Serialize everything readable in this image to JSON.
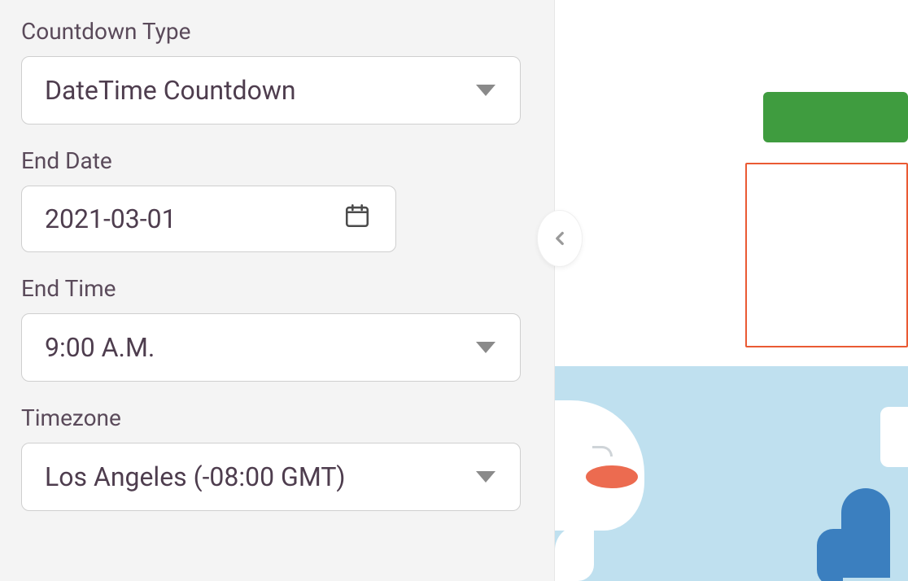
{
  "sidebar": {
    "countdown_type": {
      "label": "Countdown Type",
      "value": "DateTime Countdown"
    },
    "end_date": {
      "label": "End Date",
      "value": "2021-03-01"
    },
    "end_time": {
      "label": "End Time",
      "value": "9:00 A.M."
    },
    "timezone": {
      "label": "Timezone",
      "value": "Los Angeles (-08:00 GMT)"
    }
  },
  "colors": {
    "accent_green": "#3f9c3f",
    "outline_orange": "#ea5a33",
    "sky": "#bfe0ef"
  }
}
